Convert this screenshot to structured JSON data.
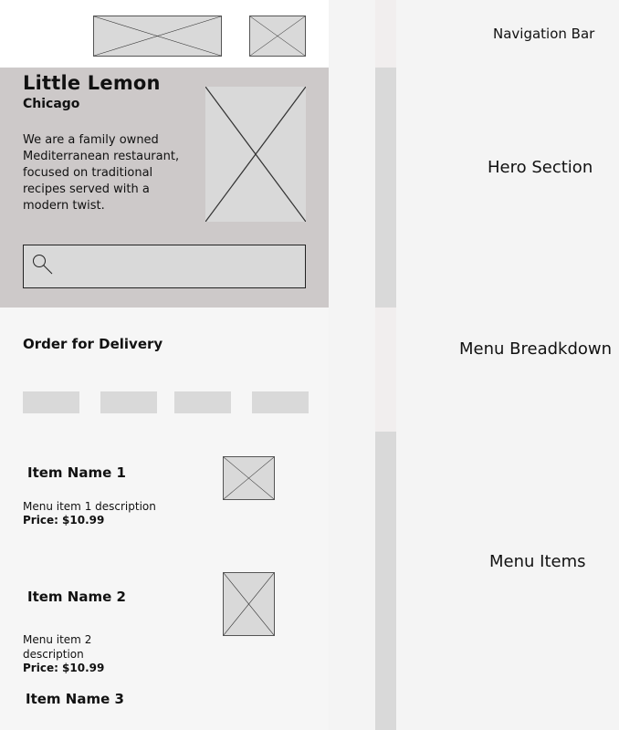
{
  "brand": {
    "name": "Little Lemon",
    "location": "Chicago",
    "description": "We are a family owned Mediterranean restaurant, focused on traditional recipes served with a modern twist."
  },
  "order": {
    "title": "Order for Delivery"
  },
  "menu_items": [
    {
      "name": "Item Name 1",
      "description": "Menu item 1 description",
      "price": "Price: $10.99"
    },
    {
      "name": "Item Name 2",
      "description": "Menu item  2 description",
      "price": "Price: $10.99"
    },
    {
      "name": "Item Name 3"
    }
  ],
  "annotations": {
    "nav": "Navigation Bar",
    "hero": "Hero Section",
    "breakdown": "Menu Breadkdown",
    "items": "Menu Items"
  },
  "colors": {
    "hero_bg": "#cdc9c9",
    "placeholder": "#d9d9d9",
    "page_bg": "#f4f4f4"
  }
}
